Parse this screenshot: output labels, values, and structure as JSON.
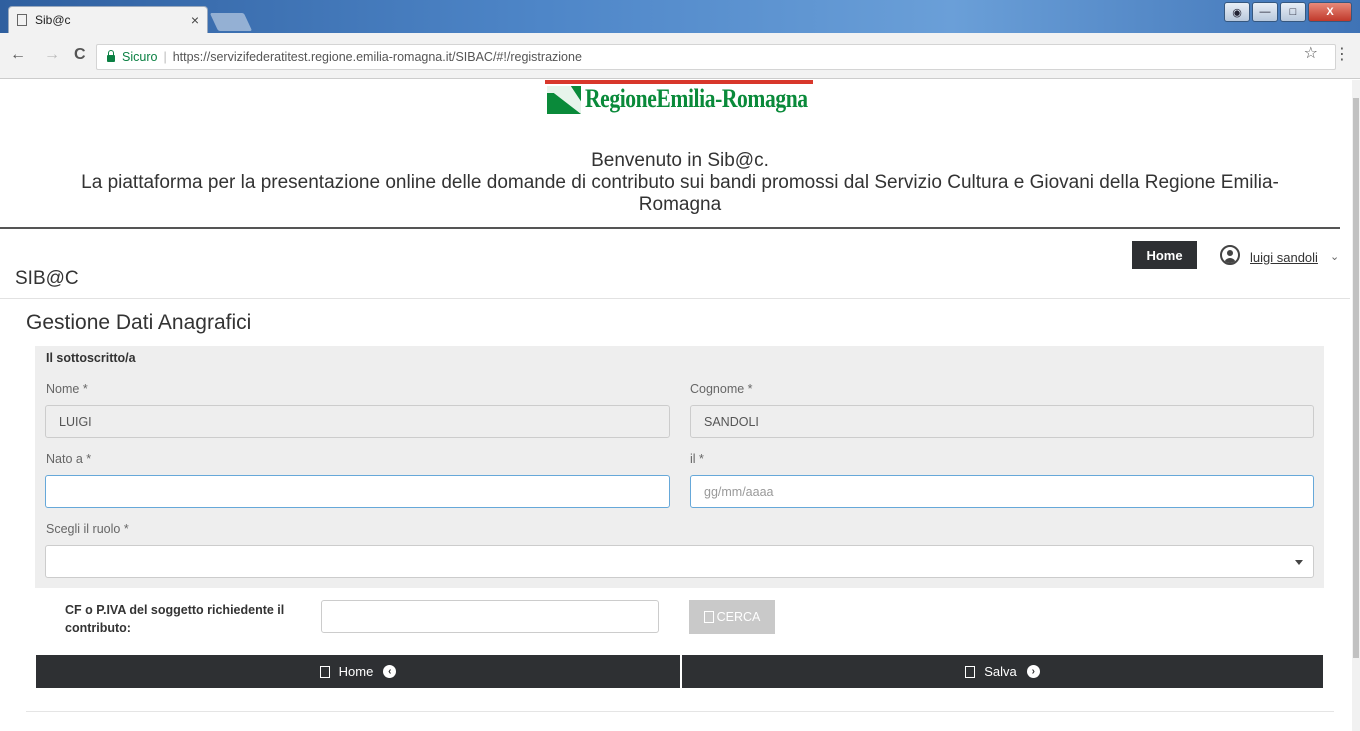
{
  "browser": {
    "tab_title": "Sib@c",
    "tab_close": "×",
    "secure_label": "Sicuro",
    "separator": "|",
    "url": "https://servizifederatitest.regione.emilia-romagna.it/SIBAC/#!/registrazione",
    "back": "←",
    "forward": "→",
    "reload": "C",
    "star": "☆",
    "menu": "⋮",
    "win_min": "—",
    "win_max": "□",
    "win_close": "X"
  },
  "header": {
    "logo_text": "RegioneEmilia-Romagna",
    "welcome_line1": "Benvenuto in Sib@c.",
    "welcome_line2": "La piattaforma per la presentazione online delle domande di contributo sui bandi promossi dal Servizio Cultura e Giovani della Regione Emilia-",
    "welcome_line3": "Romagna"
  },
  "navbar": {
    "app_name": "SIB@C",
    "home_label": "Home",
    "user_name": "luigi sandoli",
    "user_caret": "⌄"
  },
  "form": {
    "title": "Gestione Dati Anagrafici",
    "section_label": "Il sottoscritto/a",
    "nome_label": "Nome *",
    "nome_value": "LUIGI",
    "cognome_label": "Cognome *",
    "cognome_value": "SANDOLI",
    "nato_label": "Nato a *",
    "nato_value": "",
    "il_label": "il *",
    "il_placeholder": "gg/mm/aaaa",
    "ruolo_label": "Scegli il ruolo *",
    "ruolo_value": "",
    "cf_label": "CF o P.IVA del soggetto richiedente il contributo:",
    "cf_value": "",
    "cerca_label": "CERCA"
  },
  "footer": {
    "home_label": "Home",
    "salva_label": "Salva"
  }
}
